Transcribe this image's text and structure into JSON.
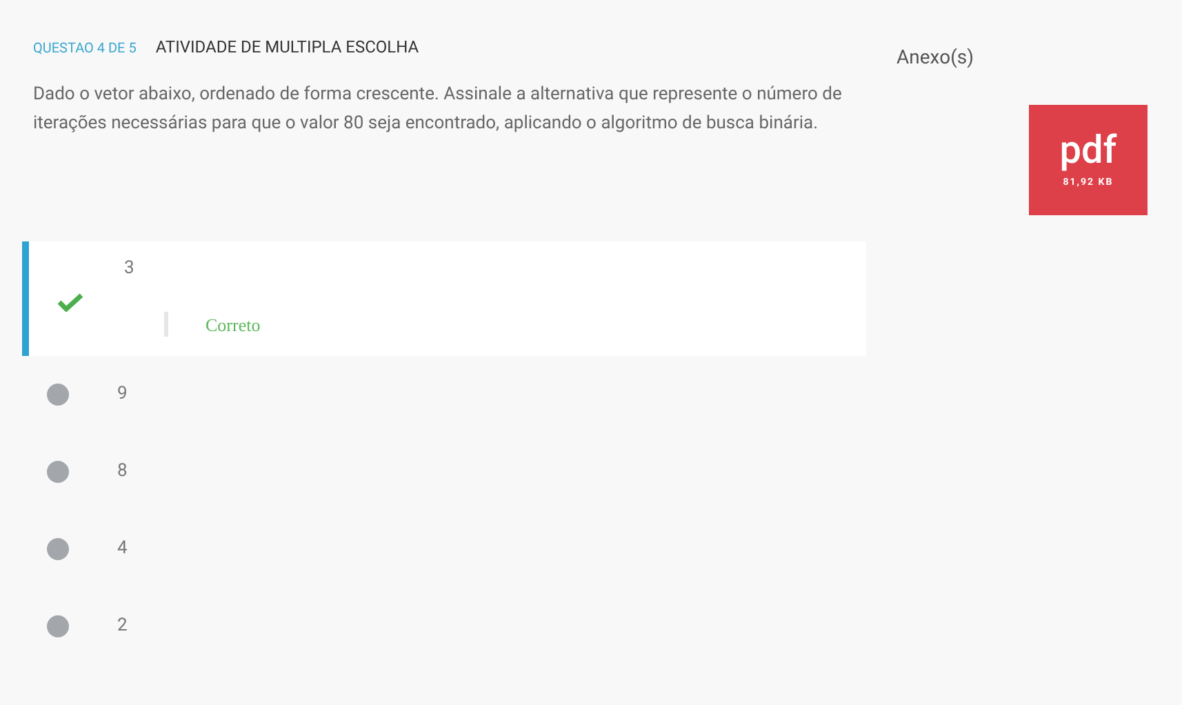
{
  "question": {
    "counter": "QUESTAO 4 DE 5",
    "type": "ATIVIDADE DE MULTIPLA ESCOLHA",
    "text": "Dado o vetor abaixo, ordenado de forma crescente. Assinale a alternativa que represente o número de iterações necessárias para que o valor 80 seja encontrado, aplicando o algoritmo de busca binária."
  },
  "options": [
    {
      "label": "3",
      "selected": true,
      "feedback": "Correto"
    },
    {
      "label": "9",
      "selected": false
    },
    {
      "label": "8",
      "selected": false
    },
    {
      "label": "4",
      "selected": false
    },
    {
      "label": "2",
      "selected": false
    }
  ],
  "attachments": {
    "title": "Anexo(s)",
    "files": [
      {
        "type": "pdf",
        "size": "81,92 KB"
      }
    ]
  }
}
